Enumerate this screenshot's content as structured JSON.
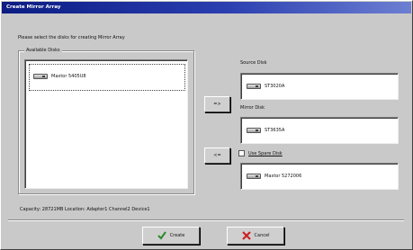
{
  "window": {
    "title": "Create Mirror Array"
  },
  "instruction": "Please select the disks for creating Mirror Array",
  "available": {
    "legend": "Available Disks",
    "items": [
      {
        "label": "Maxtor 5405U8"
      }
    ]
  },
  "source": {
    "label": "Source Disk",
    "disk": "ST3020A"
  },
  "mirror": {
    "label": "Mirror Disk",
    "disk": "ST3635A"
  },
  "spare": {
    "label": "Use Spare Disk",
    "disk": "Maxtor 5272006"
  },
  "buttons": {
    "add": "=>",
    "remove": "<=",
    "create": "Create",
    "cancel": "Cancel"
  },
  "status": "Capacity: 28721MB   Location: Adapter1 Channel2 Device1",
  "colors": {
    "titlebar": "#0b1c83",
    "create_icon": "#2a8a2a",
    "cancel_icon": "#cc2222"
  },
  "icons": {
    "create": "check-icon",
    "cancel": "x-icon",
    "disk": "hard-disk-icon"
  }
}
